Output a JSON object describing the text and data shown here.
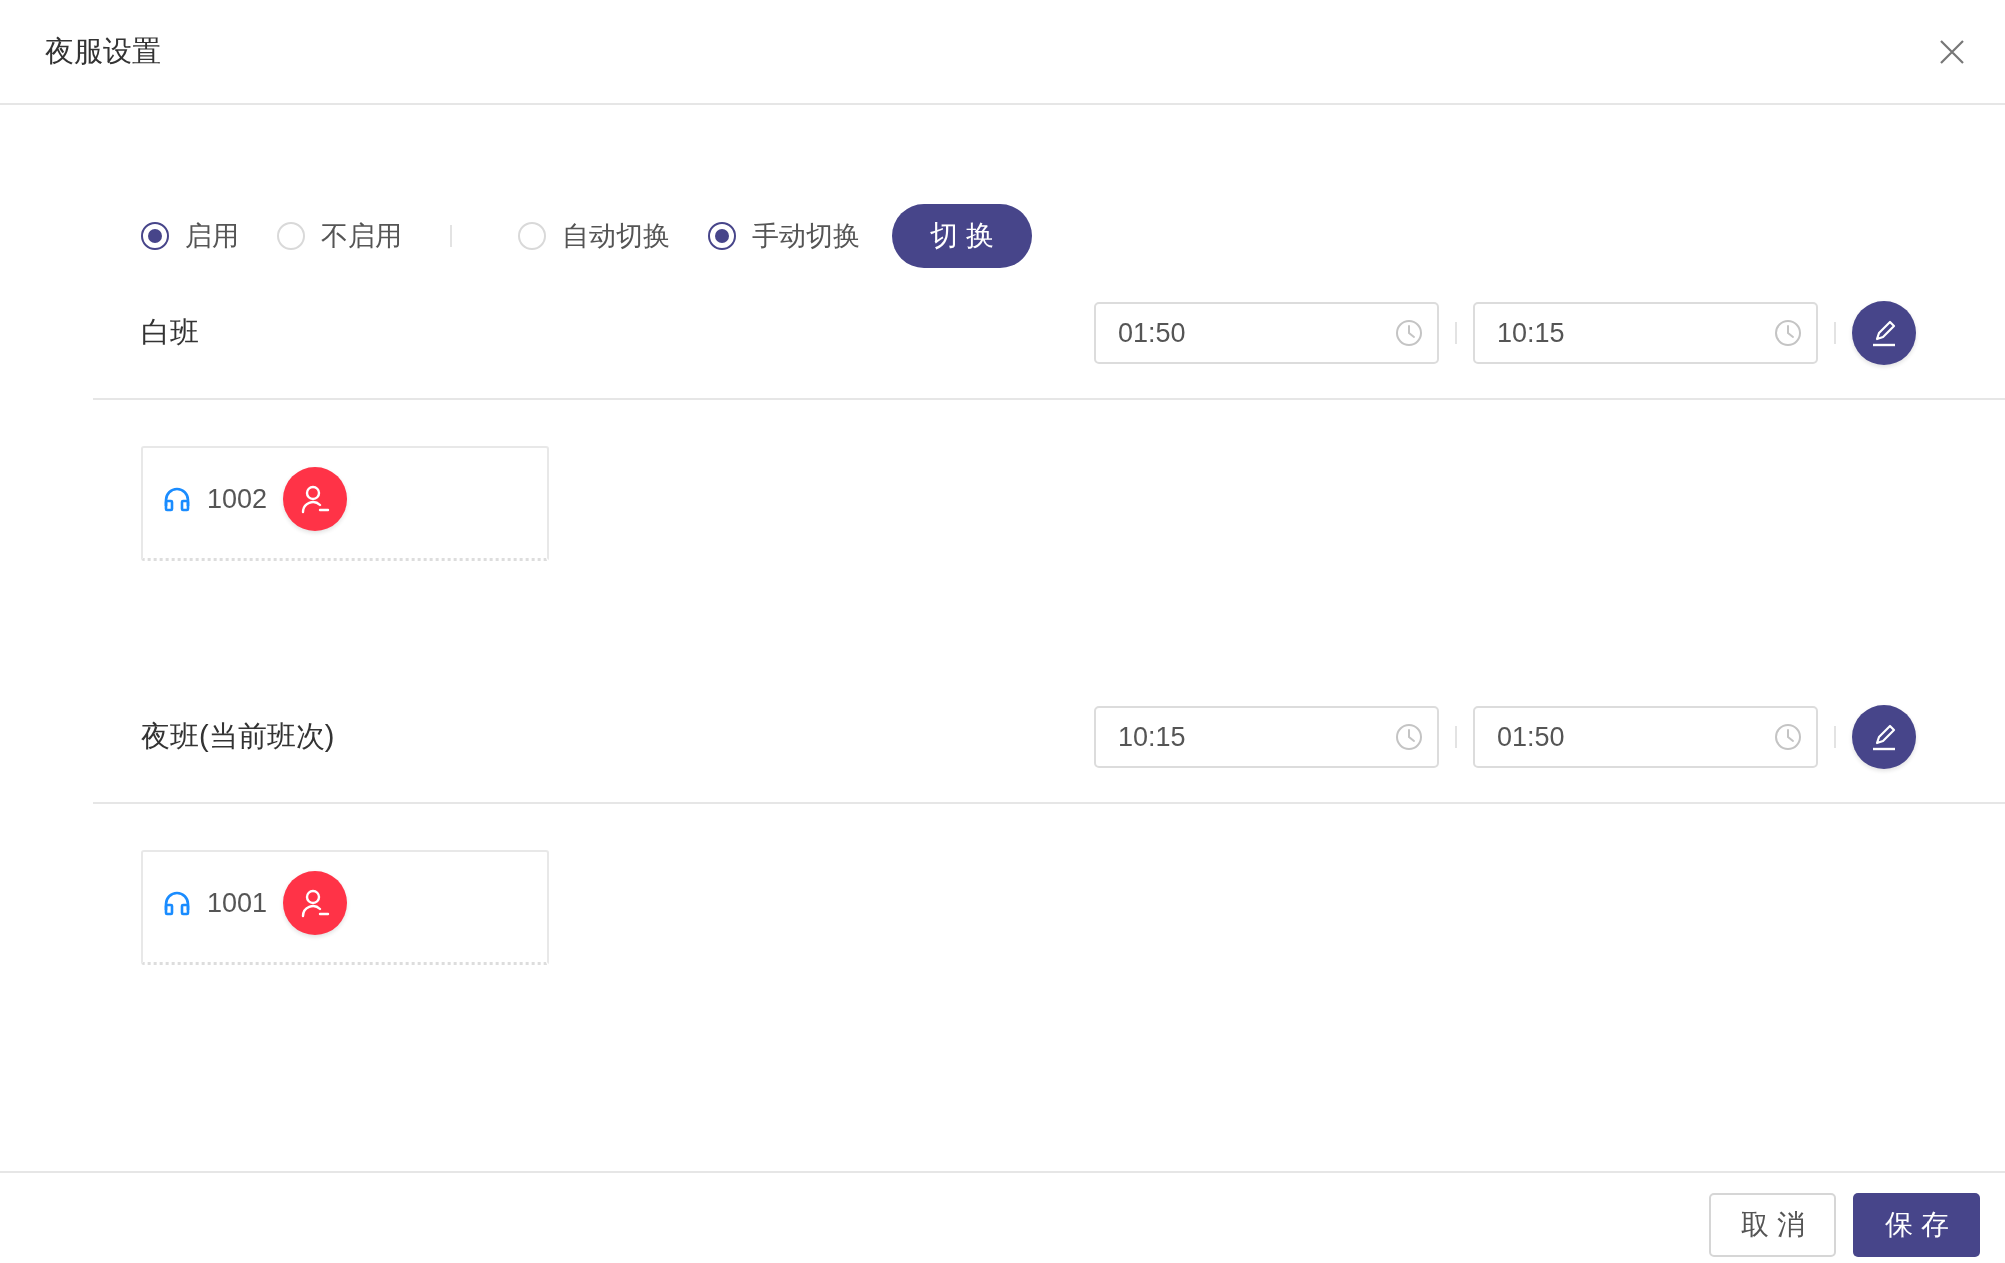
{
  "dialog": {
    "title": "夜服设置"
  },
  "enable_options": [
    {
      "label": "启用",
      "selected": true
    },
    {
      "label": "不启用",
      "selected": false
    }
  ],
  "switch_mode_options": [
    {
      "label": "自动切换",
      "selected": false
    },
    {
      "label": "手动切换",
      "selected": true
    }
  ],
  "switch_button": "切换",
  "shifts": [
    {
      "name": "白班",
      "start_time": "01:50",
      "end_time": "10:15",
      "agents": [
        {
          "extension": "1002"
        }
      ]
    },
    {
      "name": "夜班(当前班次)",
      "start_time": "10:15",
      "end_time": "01:50",
      "agents": [
        {
          "extension": "1001"
        }
      ]
    }
  ],
  "buttons": [
    {
      "label": "取消",
      "kind": "secondary"
    },
    {
      "label": "保存",
      "kind": "primary"
    }
  ]
}
